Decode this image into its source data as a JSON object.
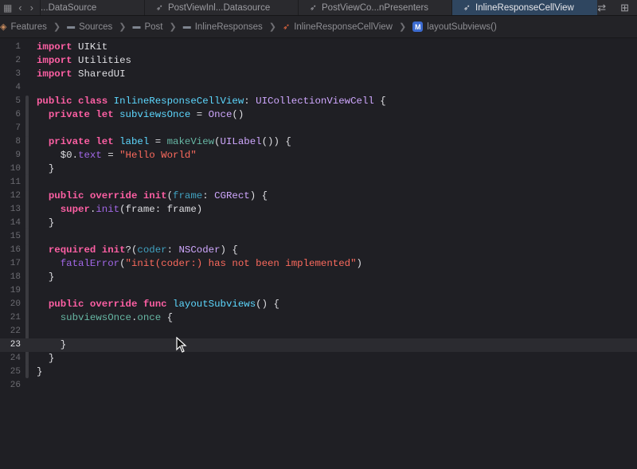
{
  "tabs": [
    {
      "label": "...DataSource",
      "active": false
    },
    {
      "label": "PostViewInl...Datasource",
      "active": false
    },
    {
      "label": "PostViewCo...nPresenters",
      "active": false
    },
    {
      "label": "InlineResponseCellView",
      "active": true
    }
  ],
  "breadcrumb": {
    "items": [
      "Features",
      "Sources",
      "Post",
      "InlineResponses",
      "InlineResponseCellView",
      "layoutSubviews()"
    ],
    "method_badge": "M"
  },
  "editor": {
    "current_line": 23,
    "line_numbers": [
      "1",
      "2",
      "3",
      "4",
      "5",
      "6",
      "7",
      "8",
      "9",
      "10",
      "11",
      "12",
      "13",
      "14",
      "15",
      "16",
      "17",
      "18",
      "19",
      "20",
      "21",
      "22",
      "23",
      "24",
      "25",
      "26"
    ],
    "lines": [
      [
        [
          "kw",
          "import"
        ],
        [
          "pl",
          " UIKit"
        ]
      ],
      [
        [
          "kw",
          "import"
        ],
        [
          "pl",
          " Utilities"
        ]
      ],
      [
        [
          "kw",
          "import"
        ],
        [
          "pl",
          " SharedUI"
        ]
      ],
      [],
      [
        [
          "kw",
          "public class"
        ],
        [
          "pl",
          " "
        ],
        [
          "type",
          "InlineResponseCellView"
        ],
        [
          "pl",
          ": "
        ],
        [
          "ptype",
          "UICollectionViewCell"
        ],
        [
          "pl",
          " {"
        ]
      ],
      [
        [
          "pl",
          "  "
        ],
        [
          "kw",
          "private let"
        ],
        [
          "pl",
          " "
        ],
        [
          "type",
          "subviewsOnce"
        ],
        [
          "pl",
          " = "
        ],
        [
          "ptype",
          "Once"
        ],
        [
          "pl",
          "()"
        ]
      ],
      [],
      [
        [
          "pl",
          "  "
        ],
        [
          "kw",
          "private let"
        ],
        [
          "pl",
          " "
        ],
        [
          "type",
          "label"
        ],
        [
          "pl",
          " = "
        ],
        [
          "prop",
          "makeView"
        ],
        [
          "pl",
          "("
        ],
        [
          "ptype",
          "UILabel"
        ],
        [
          "pl",
          "()) {"
        ]
      ],
      [
        [
          "pl",
          "    $0."
        ],
        [
          "member",
          "text"
        ],
        [
          "pl",
          " = "
        ],
        [
          "str",
          "\"Hello World\""
        ]
      ],
      [
        [
          "pl",
          "  }"
        ]
      ],
      [],
      [
        [
          "pl",
          "  "
        ],
        [
          "kw",
          "public override init"
        ],
        [
          "pl",
          "("
        ],
        [
          "param",
          "frame"
        ],
        [
          "pl",
          ": "
        ],
        [
          "ptype",
          "CGRect"
        ],
        [
          "pl",
          ") {"
        ]
      ],
      [
        [
          "pl",
          "    "
        ],
        [
          "kw",
          "super"
        ],
        [
          "pl",
          "."
        ],
        [
          "member",
          "init"
        ],
        [
          "pl",
          "(frame: frame)"
        ]
      ],
      [
        [
          "pl",
          "  }"
        ]
      ],
      [],
      [
        [
          "pl",
          "  "
        ],
        [
          "kw",
          "required init"
        ],
        [
          "pl",
          "?("
        ],
        [
          "param",
          "coder"
        ],
        [
          "pl",
          ": "
        ],
        [
          "ptype",
          "NSCoder"
        ],
        [
          "pl",
          ") {"
        ]
      ],
      [
        [
          "pl",
          "    "
        ],
        [
          "fn2",
          "fatalError"
        ],
        [
          "pl",
          "("
        ],
        [
          "str",
          "\"init(coder:) has not been implemented\""
        ],
        [
          "pl",
          ")"
        ]
      ],
      [
        [
          "pl",
          "  }"
        ]
      ],
      [],
      [
        [
          "pl",
          "  "
        ],
        [
          "kw",
          "public override func"
        ],
        [
          "pl",
          " "
        ],
        [
          "type",
          "layoutSubviews"
        ],
        [
          "pl",
          "() {"
        ]
      ],
      [
        [
          "pl",
          "    "
        ],
        [
          "prop",
          "subviewsOnce"
        ],
        [
          "pl",
          "."
        ],
        [
          "prop",
          "once"
        ],
        [
          "pl",
          " {"
        ]
      ],
      [],
      [
        [
          "pl",
          "    }"
        ]
      ],
      [
        [
          "pl",
          "  }"
        ]
      ],
      [
        [
          "pl",
          "}"
        ]
      ],
      []
    ]
  }
}
